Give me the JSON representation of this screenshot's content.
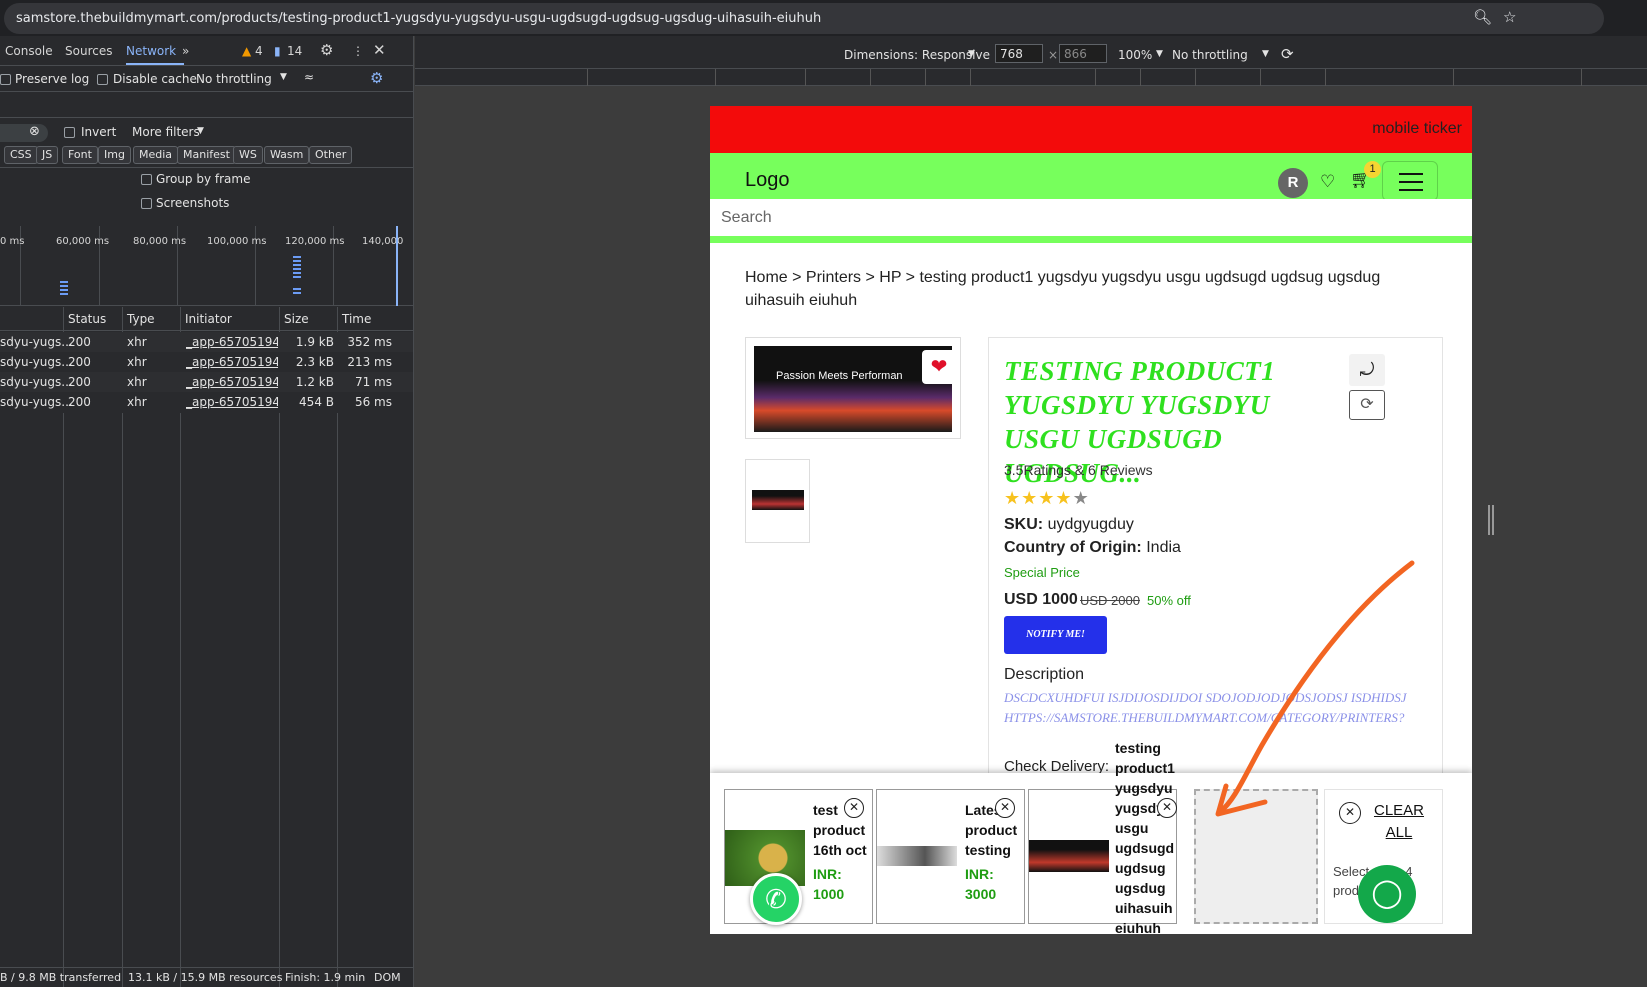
{
  "browser": {
    "url": "samstore.thebuildmymart.com/products/testing-product1-yugsdyu-yugsdyu-usgu-ugdsugd-ugdsug-ugsdug-uihasuih-eiuhuh"
  },
  "devtools": {
    "tabs": [
      "Console",
      "Sources",
      "Network"
    ],
    "active_tab": "Network",
    "warnings_count": "4",
    "messages_count": "14",
    "preserve_log": "Preserve log",
    "disable_cache": "Disable cache",
    "throttling": "No throttling",
    "invert": "Invert",
    "more_filters": "More filters",
    "filter_types": [
      "CSS",
      "JS",
      "Font",
      "Img",
      "Media",
      "Manifest",
      "WS",
      "Wasm",
      "Other"
    ],
    "group_by_frame": "Group by frame",
    "screenshots": "Screenshots",
    "timeline_ticks": [
      "0 ms",
      "60,000 ms",
      "80,000 ms",
      "100,000 ms",
      "120,000 ms",
      "140,000"
    ],
    "columns": [
      "Status",
      "Type",
      "Initiator",
      "Size",
      "Time"
    ],
    "rows": [
      {
        "name": "sdyu-yugs...",
        "status": "200",
        "type": "xhr",
        "initiator": "_app-657051948e0",
        "size": "1.9 kB",
        "time": "352 ms"
      },
      {
        "name": "sdyu-yugs...",
        "status": "200",
        "type": "xhr",
        "initiator": "_app-657051948e0",
        "size": "2.3 kB",
        "time": "213 ms"
      },
      {
        "name": "sdyu-yugs...",
        "status": "200",
        "type": "xhr",
        "initiator": "_app-657051948e0",
        "size": "1.2 kB",
        "time": "71 ms"
      },
      {
        "name": "sdyu-yugs...",
        "status": "200",
        "type": "xhr",
        "initiator": "_app-657051948e0",
        "size": "454 B",
        "time": "56 ms"
      }
    ],
    "status_bar": [
      "B / 9.8 MB transferred",
      "13.1 kB / 15.9 MB resources",
      "Finish: 1.9 min",
      "DOM"
    ]
  },
  "device_toolbar": {
    "dimensions_label": "Dimensions: Responsive",
    "width": "768",
    "height": "866",
    "zoom": "100%",
    "throttling": "No throttling"
  },
  "site": {
    "ticker": "mobile ticker",
    "logo": "Logo",
    "avatar_initial": "R",
    "cart_count": "1",
    "search_placeholder": "Search",
    "breadcrumb": "Home > Printers > HP > testing product1 yugsdyu yugsdyu usgu ugdsugd ugdsug ugsdug uihasuih eiuhuh",
    "main_image_text": "Passion Meets Performan",
    "product_title": "TESTING PRODUCT1 YUGSDYU YUGSDYU USGU UGDSUGD UGDSUG...",
    "ratings": "3.5Ratings & 6 Reviews",
    "rating_value": 3.5,
    "sku_label": "SKU:",
    "sku": "uydgyugduy",
    "country_label": "Country of Origin:",
    "country": "India",
    "special_price": "Special Price",
    "price": "USD 1000",
    "old_price": "USD 2000",
    "discount": "50% off",
    "notify_button": "NOTIFY ME!",
    "description_label": "Description",
    "description": "DSCDCXUHDFUI ISJDIJOSDIJDOI SDOJODJODJODSJODSJ ISDHIDSJ HTTPS://SAMSTORE.THEBUILDMYMART.COM/CATEGORY/PRINTERS?",
    "check_delivery": "Check Delivery:"
  },
  "compare_bar": {
    "items": [
      {
        "name": "test product 16th oct",
        "price": "INR: 1000"
      },
      {
        "name": "Latest product testing",
        "price": "INR: 3000"
      },
      {
        "name": "testing product1 yugsdyu yugsdyu usgu ugdsugd ugdsug ugsdug uihasuih eiuhuh",
        "price": ""
      }
    ],
    "clear_all": "CLEAR ALL",
    "hint": "Select up to 4 produ comp"
  },
  "colors": {
    "ticker": "#f30b0b",
    "header": "#77ff5c",
    "title": "#2fe01f",
    "notify": "#2430ea",
    "annotation_arrow": "#f26522"
  }
}
